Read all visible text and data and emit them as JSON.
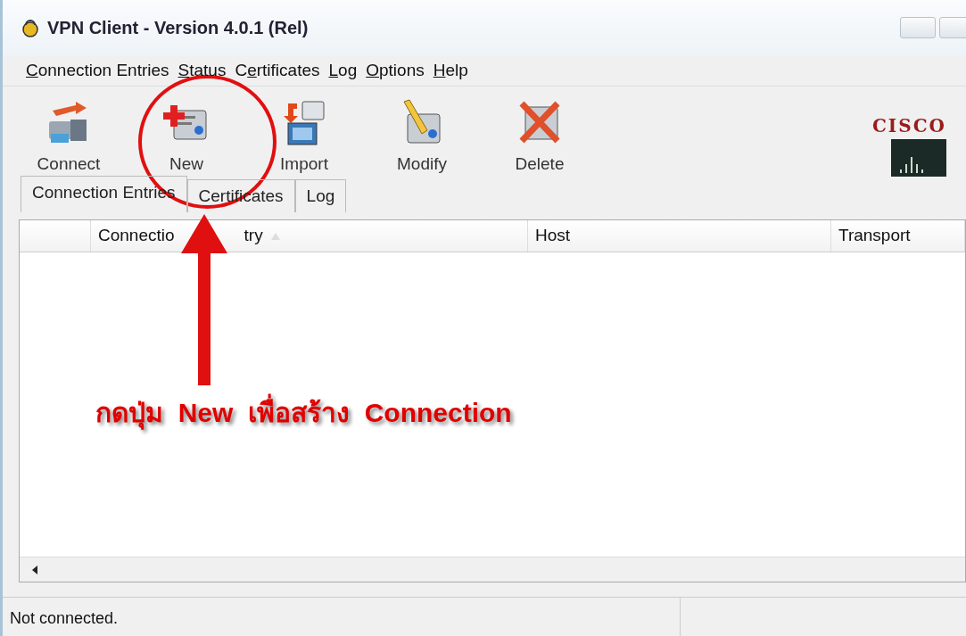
{
  "window": {
    "title": "VPN Client - Version 4.0.1 (Rel)"
  },
  "menu": [
    {
      "key": "C",
      "after": "onnection Entries"
    },
    {
      "key": "S",
      "after": "tatus"
    },
    {
      "before": "C",
      "key": "e",
      "after": "rtificates"
    },
    {
      "key": "L",
      "after": "og"
    },
    {
      "key": "O",
      "after": "ptions"
    },
    {
      "key": "H",
      "after": "elp"
    }
  ],
  "toolbar": [
    {
      "label": "Connect",
      "kind": "connect"
    },
    {
      "label": "New",
      "kind": "new"
    },
    {
      "label": "Import",
      "kind": "import"
    },
    {
      "label": "Modify",
      "kind": "modify"
    },
    {
      "label": "Delete",
      "kind": "delete"
    }
  ],
  "logo": {
    "text": "CISCO"
  },
  "tabs": [
    {
      "label": "Connection Entries",
      "selected": true
    },
    {
      "label": "Certificates",
      "selected": false
    },
    {
      "label": "Log",
      "selected": false
    }
  ],
  "table": {
    "columns": [
      {
        "sorted": false
      },
      {
        "label": "Connectio",
        "label_after_arrow": "try",
        "sorted": true
      },
      {
        "label": "Host",
        "sorted": false
      },
      {
        "label": "Transport",
        "sorted": false
      }
    ]
  },
  "status_bar": {
    "text": "Not connected."
  },
  "annotation": {
    "text": "กดปุ่ม  New  เพื่อสร้าง  Connection"
  }
}
